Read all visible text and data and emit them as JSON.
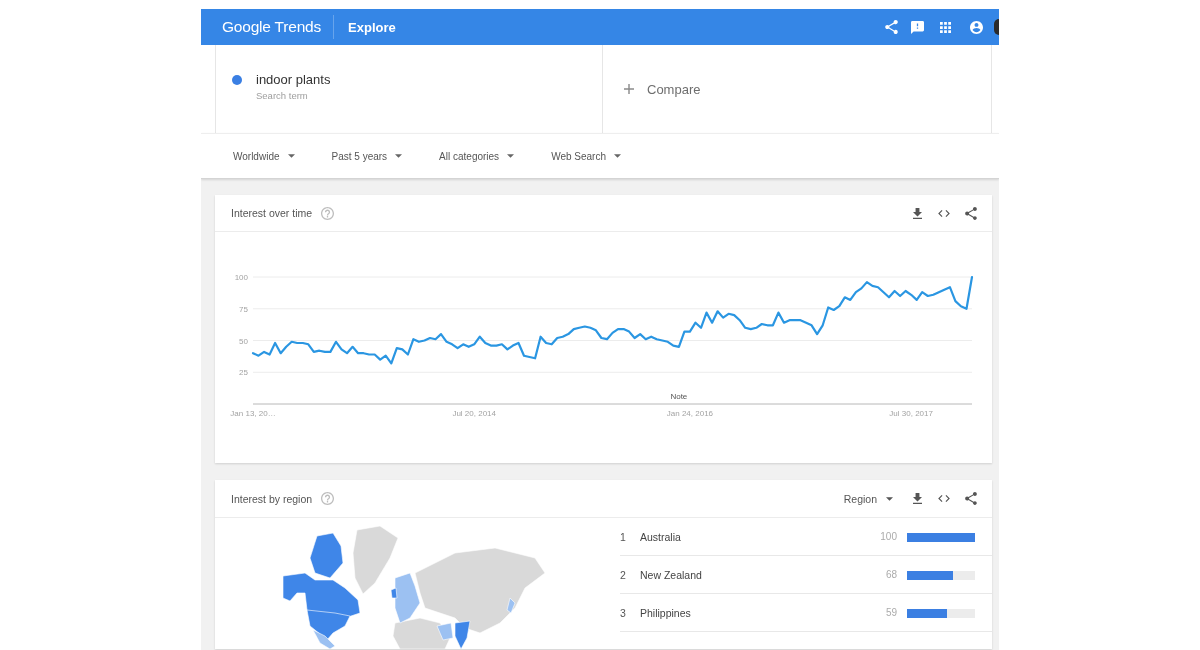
{
  "header": {
    "logo": "Google Trends",
    "section": "Explore"
  },
  "search_terms": [
    {
      "term": "indoor plants",
      "subtitle": "Search term",
      "color": "#3a7fe3"
    }
  ],
  "compare": {
    "label": "Compare"
  },
  "filters": [
    "Worldwide",
    "Past 5 years",
    "All categories",
    "Web Search"
  ],
  "interest_over_time": {
    "title": "Interest over time",
    "chart_data": {
      "type": "line",
      "categories": [
        "Jan 13, 20…",
        null,
        null,
        null,
        null,
        null,
        null,
        null,
        null,
        null,
        null,
        null,
        null,
        null,
        null,
        null,
        null,
        null,
        null,
        null,
        null,
        null,
        null,
        null,
        null,
        null,
        null,
        null,
        null,
        null,
        null,
        null,
        null,
        null,
        null,
        null,
        null,
        null,
        null,
        null,
        "Jul 20, 2014",
        null,
        null,
        null,
        null,
        null,
        null,
        null,
        null,
        null,
        null,
        null,
        null,
        null,
        null,
        null,
        null,
        null,
        null,
        null,
        null,
        null,
        null,
        null,
        null,
        null,
        null,
        null,
        null,
        null,
        null,
        null,
        null,
        null,
        null,
        null,
        null,
        null,
        null,
        "Jan 24, 2016",
        null,
        null,
        null,
        null,
        null,
        null,
        null,
        null,
        null,
        null,
        null,
        null,
        null,
        null,
        null,
        null,
        null,
        null,
        null,
        null,
        null,
        null,
        null,
        null,
        null,
        null,
        null,
        null,
        null,
        null,
        null,
        null,
        null,
        null,
        null,
        null,
        null,
        null,
        null,
        "Jul 30, 2017",
        null,
        null,
        null,
        null,
        null,
        null,
        null,
        null,
        null,
        null,
        null
      ],
      "series": [
        {
          "color": "#2a96e2",
          "values": [
            40,
            38,
            41,
            39,
            48,
            40,
            45,
            49,
            48,
            48,
            47,
            41,
            42,
            41,
            41,
            49,
            43,
            40,
            45,
            40,
            40,
            39,
            39,
            35,
            38,
            32,
            44,
            43,
            39,
            51,
            49,
            50,
            52,
            51,
            55,
            49,
            47,
            44,
            47,
            45,
            47,
            53,
            48,
            46,
            46,
            47,
            43,
            46,
            48,
            38,
            37,
            36,
            53,
            48,
            47,
            52,
            53,
            55,
            59,
            60,
            61,
            60,
            58,
            52,
            51,
            56,
            59,
            59,
            57,
            52,
            55,
            51,
            53,
            51,
            50,
            49,
            46,
            45,
            57,
            57,
            64,
            60,
            72,
            64,
            73,
            68,
            71,
            70,
            66,
            60,
            59,
            60,
            63,
            62,
            62,
            72,
            64,
            66,
            66,
            66,
            64,
            62,
            55,
            62,
            76,
            74,
            77,
            84,
            82,
            88,
            91,
            96,
            93,
            92,
            88,
            84,
            89,
            85,
            89,
            86,
            82,
            88,
            85,
            86,
            88,
            90,
            92,
            81,
            77,
            75,
            100
          ]
        }
      ],
      "ylim": [
        0,
        100
      ],
      "yticks": [
        25,
        50,
        75,
        100
      ],
      "grid": true,
      "annotations": [
        "Note"
      ]
    }
  },
  "interest_by_region": {
    "title": "Interest by region",
    "resolution": "Region",
    "regions": [
      {
        "rank": "1",
        "name": "Australia",
        "value": "100",
        "level": 1.0
      },
      {
        "rank": "2",
        "name": "New Zealand",
        "value": "68",
        "level": 0.68
      },
      {
        "rank": "3",
        "name": "Philippines",
        "value": "59",
        "level": 0.59
      }
    ]
  }
}
